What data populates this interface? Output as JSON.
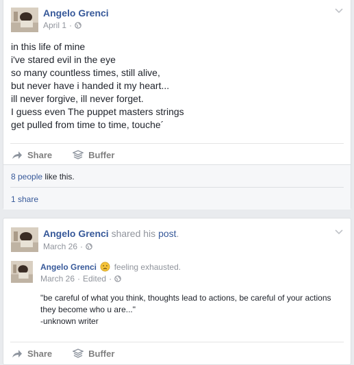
{
  "posts": [
    {
      "author": "Angelo Grenci",
      "date": "April 1",
      "date_sep": "·",
      "lines": [
        "in this life of mine",
        "i've stared evil in the eye",
        "so many countless times, still alive,",
        "but never have i handed it my heart...",
        "ill never forgive, ill never forget.",
        "I guess even The puppet masters strings",
        "get pulled from time to time, touche´"
      ],
      "actions": {
        "share": "Share",
        "buffer": "Buffer"
      },
      "likes": {
        "count_text": "8 people",
        "suffix": " like this."
      },
      "shares": "1 share"
    },
    {
      "author": "Angelo Grenci",
      "headline_mid": " shared his ",
      "headline_link": "post",
      "headline_end": ".",
      "date": "March 26",
      "date_sep": "·",
      "shared": {
        "author": "Angelo Grenci",
        "feeling": " feeling exhausted.",
        "date": "March 26",
        "date_sep": "·",
        "edited": "Edited",
        "edited_sep": "·",
        "lines": [
          "\"be careful of what you think, thoughts lead to actions, be careful of your actions",
          "they become who u are...\"",
          "-unknown writer"
        ]
      },
      "actions": {
        "share": "Share",
        "buffer": "Buffer"
      }
    }
  ],
  "colors": {
    "link": "#365899",
    "muted": "#90949c",
    "background": "#e9ebee"
  },
  "icons": [
    "chevron-down-icon",
    "globe-icon",
    "share-arrow-icon",
    "buffer-icon",
    "exhausted-emoji-icon"
  ]
}
